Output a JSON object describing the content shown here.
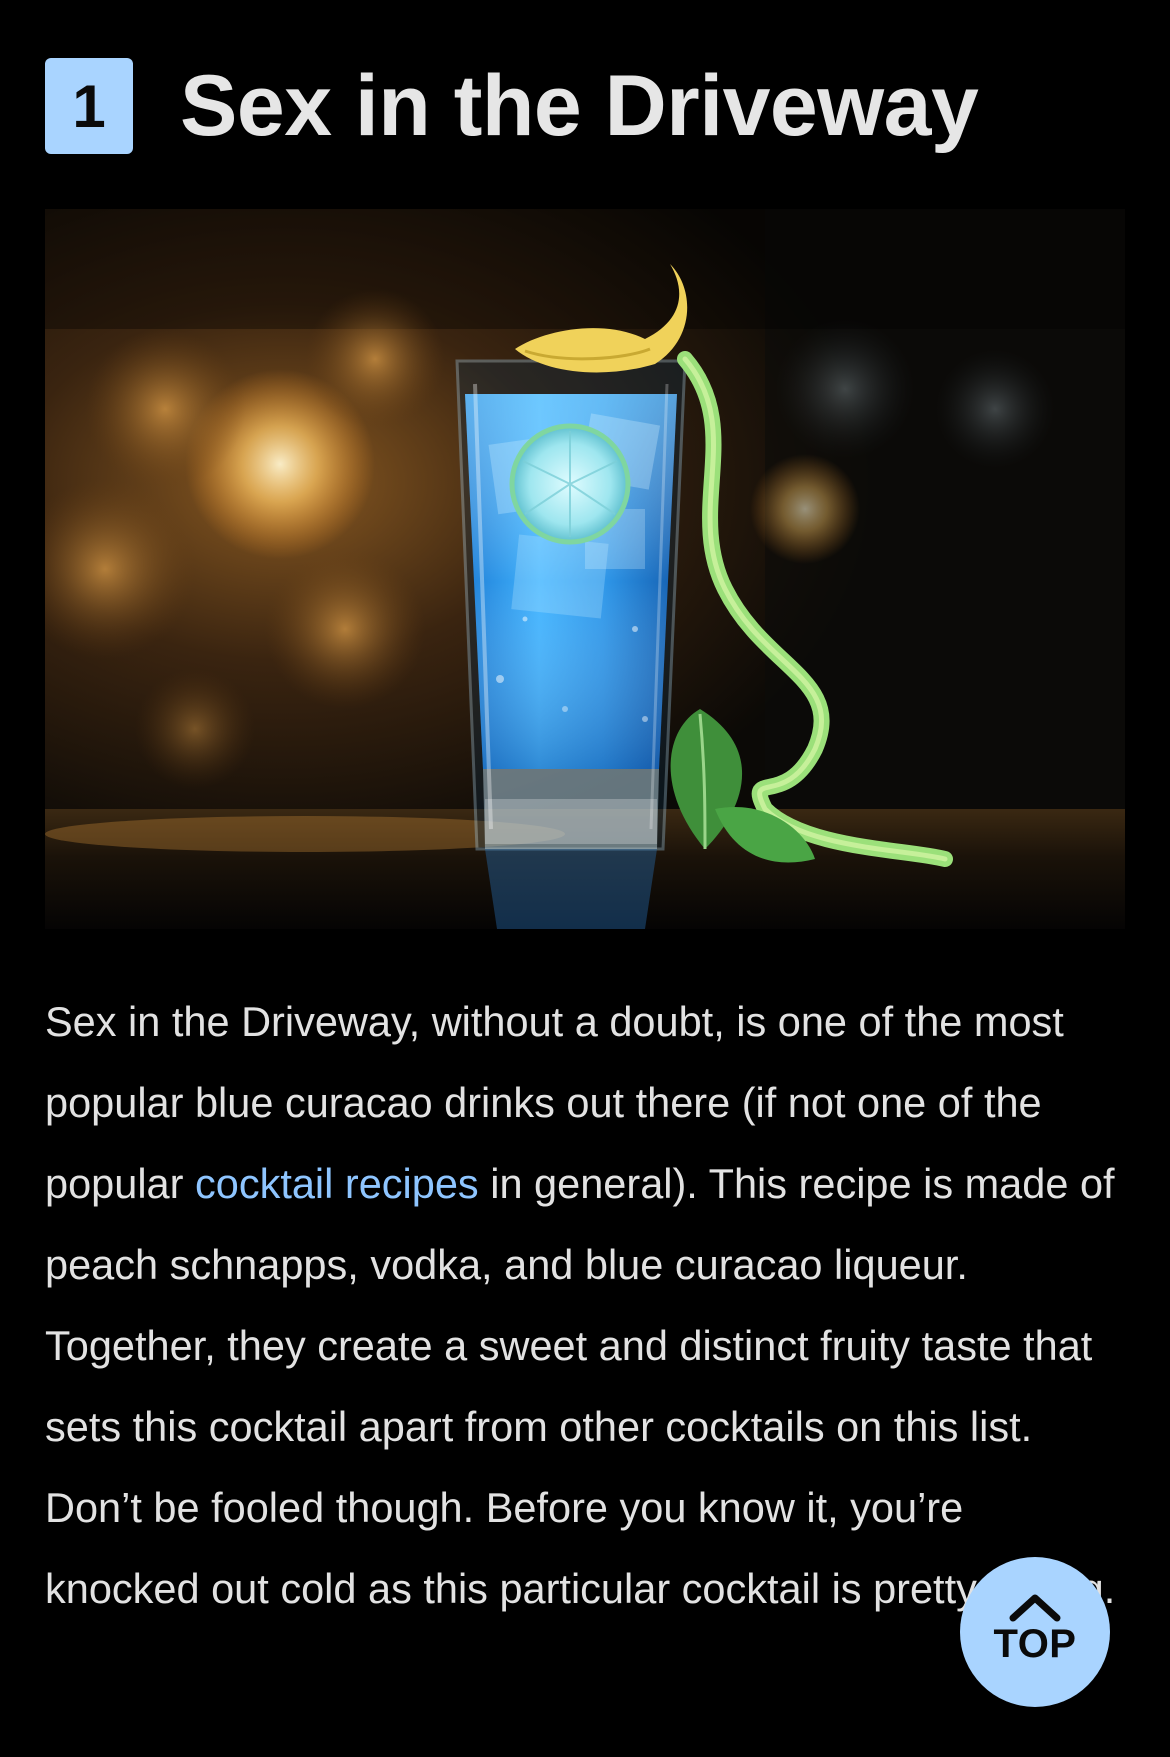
{
  "recipe": {
    "number": "1",
    "title": "Sex in the Driveway",
    "image_alt": "Blue cocktail in a tall glass with lime wheel, lemon peel and mint",
    "paragraph": {
      "part1": "Sex in the Driveway, without a doubt, is one of the most popular blue curacao drinks out there (if not one of the popular ",
      "link_text": "cocktail recipes",
      "part2": " in general). This recipe is made of peach schnapps, vodka, and blue curacao liqueur. Together, they create a sweet and distinct fruity taste that sets this cocktail apart from other cocktails on this list. Don’t be fooled though. Before you know it, you’re knocked out cold as this particular cocktail is pretty strong."
    }
  },
  "top_button": {
    "label": "TOP",
    "icon": "chevron-up-icon"
  },
  "colors": {
    "background": "#000000",
    "accent": "#a9d4ff",
    "link": "#8ec5ff",
    "text": "#e2e2e2"
  }
}
